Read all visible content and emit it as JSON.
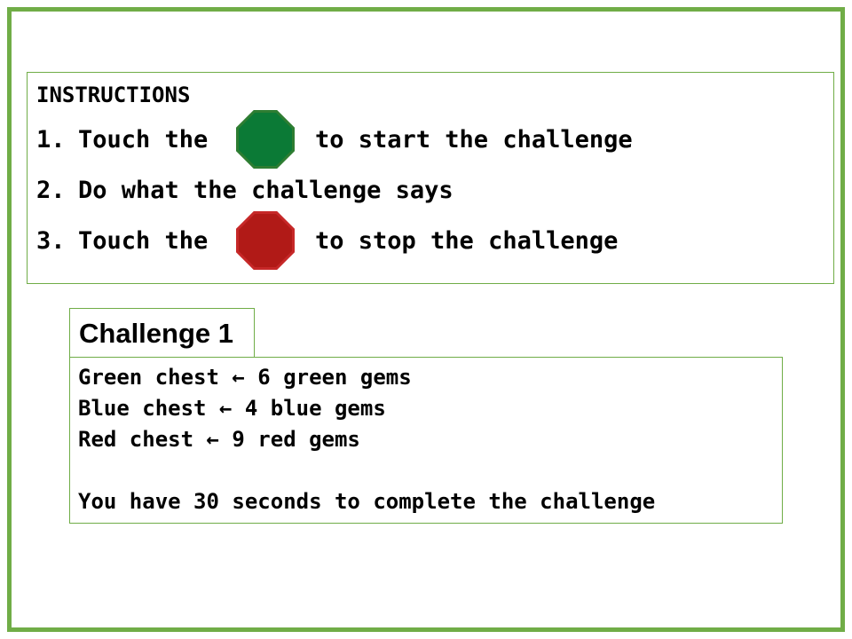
{
  "instructions": {
    "title": "INSTRUCTIONS",
    "steps": [
      {
        "number": "1.",
        "text": "Touch the",
        "after": "to start the challenge",
        "icon": "green-octagon-go-icon",
        "color": "#0b7a36"
      },
      {
        "number": "2.",
        "text": "Do what the challenge says"
      },
      {
        "number": "3.",
        "text": "Touch the",
        "after": "to stop the challenge",
        "icon": "red-octagon-stop-icon",
        "color": "#b11a17"
      }
    ]
  },
  "challenge": {
    "title": "Challenge 1",
    "lines": [
      "Green chest ← 6 green gems",
      "Blue chest ← 4 blue gems",
      "Red chest ← 9 red gems",
      "You have 30 seconds to complete the challenge"
    ]
  },
  "colors": {
    "border": "#70ad47"
  }
}
